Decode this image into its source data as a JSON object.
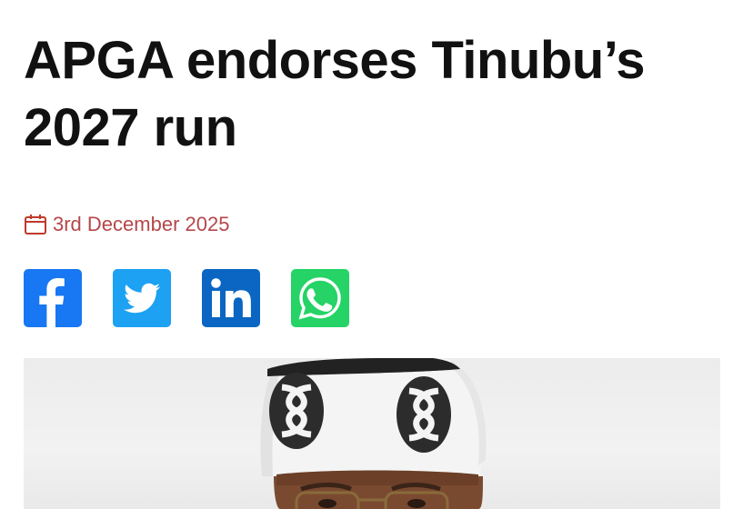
{
  "article": {
    "title": "APGA endorses Tinubu’s 2027 run",
    "date": "3rd December 2025",
    "date_icon": "calendar-icon"
  },
  "share": {
    "buttons": [
      {
        "network": "facebook",
        "icon": "facebook-icon",
        "color": "#1877f2"
      },
      {
        "network": "twitter",
        "icon": "twitter-icon",
        "color": "#1da1f2"
      },
      {
        "network": "linkedin",
        "icon": "linkedin-icon",
        "color": "#0a66c2"
      },
      {
        "network": "whatsapp",
        "icon": "whatsapp-icon",
        "color": "#25d366"
      }
    ]
  },
  "colors": {
    "headline": "#111111",
    "date": "#b5474a"
  }
}
